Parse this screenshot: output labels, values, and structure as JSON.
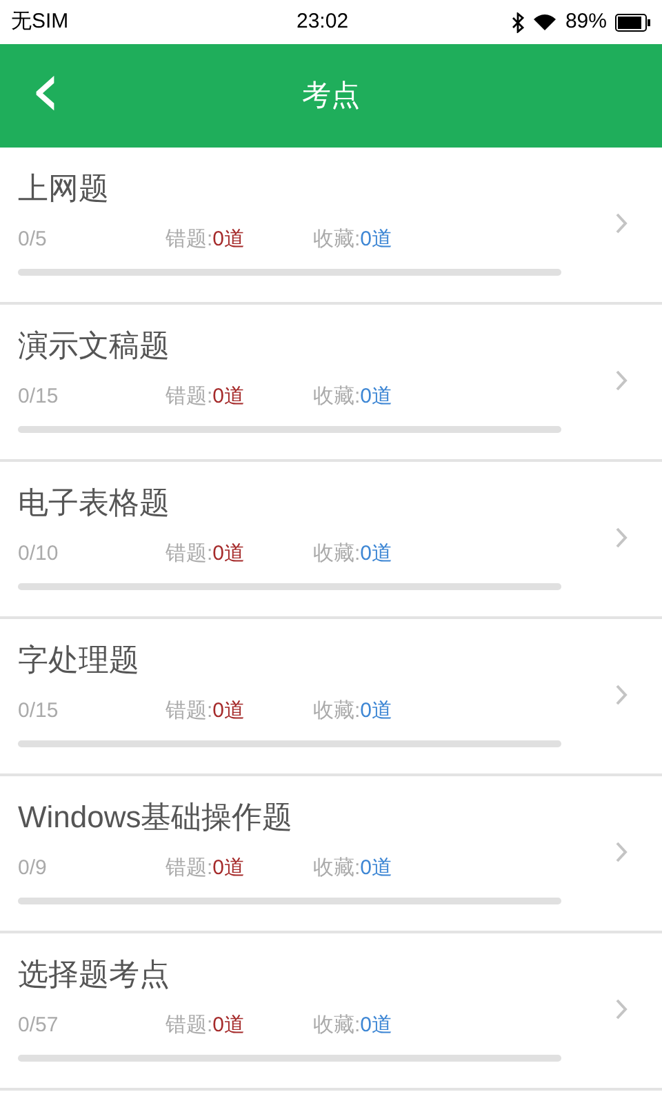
{
  "status_bar": {
    "carrier": "无SIM",
    "time": "23:02",
    "battery": "89%"
  },
  "header": {
    "back": "‹",
    "title": "考点"
  },
  "topics": [
    {
      "title": "上网题",
      "progress": "0/5",
      "level": 0,
      "wrong_label": "错题:",
      "wrong_count": "0道",
      "fav_label": "收藏:",
      "fav_count": "0道"
    },
    {
      "title": "演示文稿题",
      "progress": "0/15",
      "level": 0,
      "wrong_label": "错题:",
      "wrong_count": "0道",
      "fav_label": "收藏:",
      "fav_count": "0道"
    },
    {
      "title": "电子表格题",
      "progress": "0/10",
      "level": 0,
      "wrong_label": "错题:",
      "wrong_count": "0道",
      "fav_label": "收藏:",
      "fav_count": "0道"
    },
    {
      "title": "字处理题",
      "progress": "0/15",
      "level": 0,
      "wrong_label": "错题:",
      "wrong_count": "0道",
      "fav_label": "收藏:",
      "fav_count": "0道"
    },
    {
      "title": "Windows基础操作题",
      "progress": "0/9",
      "level": 0,
      "wrong_label": "错题:",
      "wrong_count": "0道",
      "fav_label": "收藏:",
      "fav_count": "0道"
    },
    {
      "title": "选择题考点",
      "progress": "0/57",
      "level": 0,
      "wrong_label": "错题:",
      "wrong_count": "0道",
      "fav_label": "收藏:",
      "fav_count": "0道"
    }
  ]
}
